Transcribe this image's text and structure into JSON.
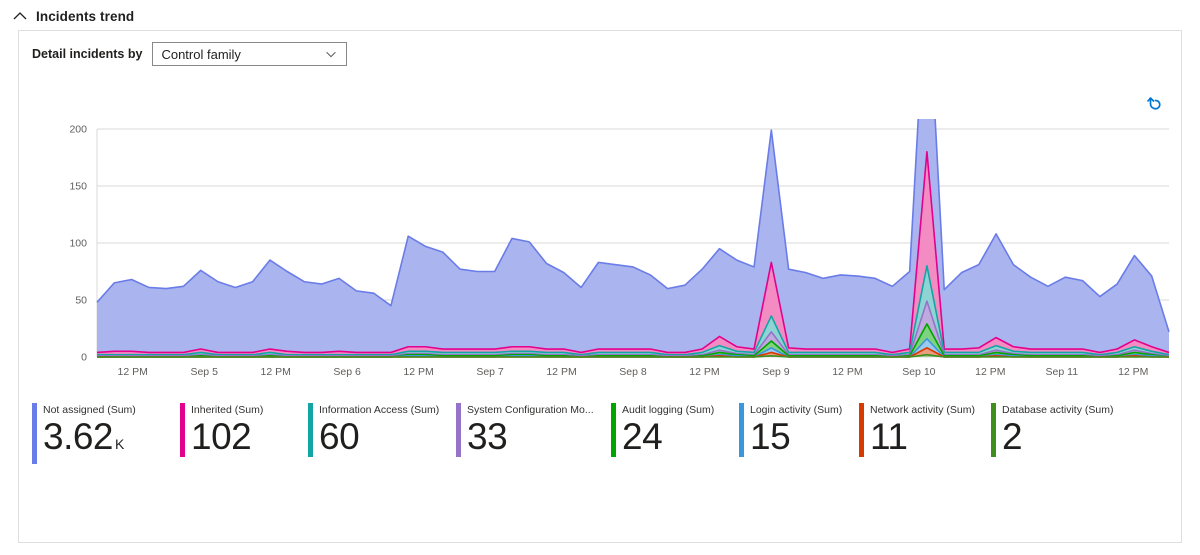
{
  "header": {
    "title": "Incidents trend",
    "collapse_icon": "chevron-up-icon"
  },
  "filter": {
    "label": "Detail incidents by",
    "dropdown_value": "Control family",
    "dropdown_icon": "chevron-down-icon"
  },
  "toolbar": {
    "reset_icon": "reset-arrow-icon"
  },
  "legend": [
    {
      "name": "Not assigned (Sum)",
      "value": "3.62",
      "unit": "K",
      "color": "#6a7ce8"
    },
    {
      "name": "Inherited (Sum)",
      "value": "102",
      "unit": "",
      "color": "#e3008c"
    },
    {
      "name": "Information Access (Sum)",
      "value": "60",
      "unit": "",
      "color": "#13a5a5"
    },
    {
      "name": "System Configuration Mo...",
      "value": "33",
      "unit": "",
      "color": "#9473c9"
    },
    {
      "name": "Audit logging (Sum)",
      "value": "24",
      "unit": "",
      "color": "#00a600"
    },
    {
      "name": "Login activity (Sum)",
      "value": "15",
      "unit": "",
      "color": "#3a96dd"
    },
    {
      "name": "Network activity (Sum)",
      "value": "11",
      "unit": "",
      "color": "#d83b01"
    },
    {
      "name": "Database activity (Sum)",
      "value": "2",
      "unit": "",
      "color": "#3e8f1e"
    }
  ],
  "chart_data": {
    "type": "area",
    "title": "Incidents trend",
    "xlabel": "",
    "ylabel": "",
    "ylim": [
      0,
      200
    ],
    "yticks": [
      0,
      50,
      100,
      150,
      200
    ],
    "grid": true,
    "legend_position": "bottom",
    "stacked": true,
    "xticks": [
      "12 PM",
      "Sep 5",
      "12 PM",
      "Sep 6",
      "12 PM",
      "Sep 7",
      "12 PM",
      "Sep 8",
      "12 PM",
      "Sep 9",
      "12 PM",
      "Sep 10",
      "12 PM",
      "Sep 11",
      "12 PM"
    ],
    "x": [
      0,
      1,
      2,
      3,
      4,
      5,
      6,
      7,
      8,
      9,
      10,
      11,
      12,
      13,
      14,
      15,
      16,
      17,
      18,
      19,
      20,
      21,
      22,
      23,
      24,
      25,
      26,
      27,
      28,
      29,
      30,
      31,
      32,
      33,
      34,
      35,
      36,
      37,
      38,
      39,
      40,
      41,
      42,
      43,
      44,
      45,
      46,
      47,
      48,
      49,
      50,
      51,
      52,
      53,
      54,
      55,
      56,
      57,
      58,
      59,
      60,
      61,
      62
    ],
    "series": [
      {
        "name": "Not assigned (Sum)",
        "color": "#6a7ce8",
        "fill": "#aab4ee",
        "values": [
          44,
          60,
          63,
          57,
          56,
          58,
          69,
          62,
          57,
          62,
          78,
          70,
          62,
          60,
          64,
          54,
          52,
          41,
          97,
          88,
          85,
          70,
          68,
          68,
          95,
          92,
          75,
          67,
          57,
          76,
          74,
          72,
          65,
          56,
          59,
          70,
          77,
          76,
          72,
          116,
          69,
          67,
          62,
          65,
          64,
          62,
          58,
          68,
          164,
          52,
          67,
          73,
          91,
          72,
          63,
          55,
          63,
          60,
          49,
          57,
          74,
          62,
          18
        ]
      },
      {
        "name": "Inherited (Sum)",
        "color": "#e3008c",
        "fill": "#f48cc4",
        "values": [
          2,
          3,
          3,
          2,
          2,
          2,
          3,
          2,
          2,
          2,
          3,
          3,
          2,
          2,
          3,
          2,
          2,
          2,
          4,
          4,
          3,
          3,
          3,
          3,
          4,
          4,
          3,
          3,
          2,
          3,
          3,
          3,
          3,
          2,
          2,
          3,
          8,
          4,
          3,
          47,
          4,
          3,
          3,
          3,
          3,
          3,
          2,
          3,
          100,
          3,
          3,
          4,
          7,
          4,
          3,
          3,
          3,
          3,
          2,
          3,
          6,
          4,
          2
        ]
      },
      {
        "name": "Information Access (Sum)",
        "color": "#13a5a5",
        "fill": "#8fd4d4",
        "values": [
          1,
          1,
          1,
          1,
          1,
          1,
          2,
          1,
          1,
          1,
          2,
          1,
          1,
          1,
          1,
          1,
          1,
          1,
          2,
          2,
          2,
          2,
          2,
          2,
          2,
          2,
          2,
          2,
          1,
          2,
          2,
          2,
          2,
          1,
          1,
          2,
          4,
          2,
          2,
          14,
          2,
          2,
          2,
          2,
          2,
          2,
          1,
          2,
          31,
          2,
          2,
          2,
          4,
          2,
          2,
          2,
          2,
          2,
          1,
          2,
          3,
          2,
          1
        ]
      },
      {
        "name": "System Configuration Mo...",
        "color": "#9473c9",
        "fill": "#bfaade",
        "values": [
          1,
          1,
          1,
          1,
          1,
          1,
          1,
          1,
          1,
          1,
          1,
          1,
          1,
          1,
          1,
          1,
          1,
          1,
          1,
          1,
          1,
          1,
          1,
          1,
          1,
          1,
          1,
          1,
          1,
          1,
          1,
          1,
          1,
          1,
          1,
          1,
          2,
          1,
          1,
          8,
          1,
          1,
          1,
          1,
          1,
          1,
          1,
          1,
          20,
          1,
          1,
          1,
          2,
          1,
          1,
          1,
          1,
          1,
          1,
          1,
          2,
          1,
          1
        ]
      },
      {
        "name": "Audit logging (Sum)",
        "color": "#00a600",
        "fill": "#7fd37f",
        "values": [
          0,
          0,
          0,
          0,
          0,
          0,
          1,
          0,
          0,
          0,
          1,
          0,
          0,
          0,
          0,
          0,
          0,
          0,
          1,
          1,
          1,
          1,
          1,
          1,
          1,
          1,
          1,
          1,
          0,
          1,
          1,
          1,
          1,
          0,
          0,
          1,
          2,
          1,
          1,
          6,
          1,
          1,
          1,
          1,
          1,
          1,
          0,
          1,
          13,
          1,
          1,
          1,
          2,
          1,
          1,
          1,
          1,
          1,
          0,
          1,
          2,
          1,
          0
        ]
      },
      {
        "name": "Login activity (Sum)",
        "color": "#3a96dd",
        "fill": "#9cc9ee",
        "values": [
          0,
          0,
          0,
          0,
          0,
          0,
          0,
          0,
          0,
          0,
          0,
          0,
          0,
          0,
          0,
          0,
          0,
          0,
          1,
          1,
          0,
          0,
          0,
          0,
          1,
          1,
          0,
          0,
          0,
          0,
          0,
          0,
          0,
          0,
          0,
          0,
          1,
          1,
          0,
          4,
          0,
          0,
          0,
          0,
          0,
          0,
          0,
          0,
          8,
          0,
          0,
          0,
          1,
          1,
          0,
          0,
          0,
          0,
          0,
          0,
          1,
          1,
          0
        ]
      },
      {
        "name": "Network activity (Sum)",
        "color": "#d83b01",
        "fill": "#eb9d80",
        "values": [
          0,
          0,
          0,
          0,
          0,
          0,
          0,
          0,
          0,
          0,
          0,
          0,
          0,
          0,
          0,
          0,
          0,
          0,
          0,
          0,
          0,
          0,
          0,
          0,
          0,
          0,
          0,
          0,
          0,
          0,
          0,
          0,
          0,
          0,
          0,
          0,
          1,
          0,
          0,
          3,
          0,
          0,
          0,
          0,
          0,
          0,
          0,
          0,
          6,
          0,
          0,
          0,
          1,
          0,
          0,
          0,
          0,
          0,
          0,
          0,
          1,
          0,
          0
        ]
      },
      {
        "name": "Database activity (Sum)",
        "color": "#3e8f1e",
        "fill": "#9ec78e",
        "values": [
          0,
          0,
          0,
          0,
          0,
          0,
          0,
          0,
          0,
          0,
          0,
          0,
          0,
          0,
          0,
          0,
          0,
          0,
          0,
          0,
          0,
          0,
          0,
          0,
          0,
          0,
          0,
          0,
          0,
          0,
          0,
          0,
          0,
          0,
          0,
          0,
          0,
          0,
          0,
          1,
          0,
          0,
          0,
          0,
          0,
          0,
          0,
          0,
          2,
          0,
          0,
          0,
          0,
          0,
          0,
          0,
          0,
          0,
          0,
          0,
          0,
          0,
          0
        ]
      }
    ]
  }
}
